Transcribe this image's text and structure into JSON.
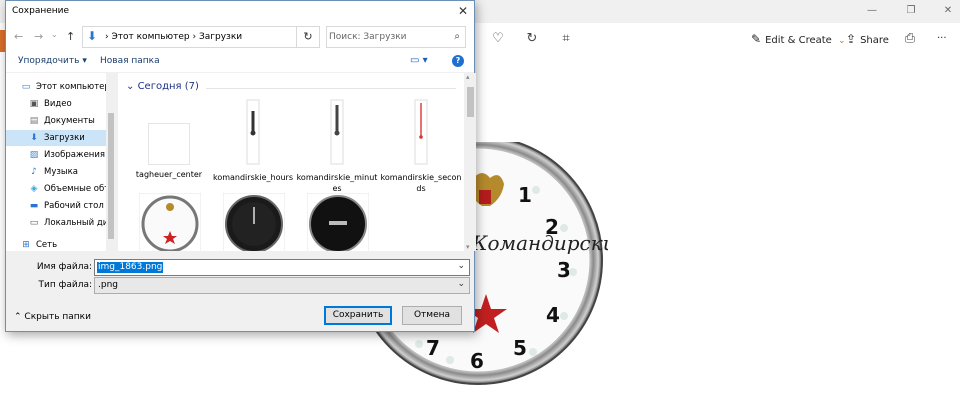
{
  "app": {
    "toolbar": {
      "edit_create": "Edit & Create",
      "share": "Share",
      "more": "···"
    },
    "photo": {
      "brand_text": "Командирские",
      "dial_numbers": [
        "1",
        "2",
        "3",
        "4",
        "5",
        "6",
        "7"
      ]
    },
    "colors": {
      "accent_orange": "#d86e2b"
    }
  },
  "dialog": {
    "title": "Сохранение",
    "address": {
      "crumb1": "Этот компьютер",
      "crumb2": "Загрузки"
    },
    "search_placeholder": "Поиск: Загрузки",
    "commands": {
      "organize": "Упорядочить",
      "new_folder": "Новая папка"
    },
    "tree": [
      {
        "label": "Этот компьютер"
      },
      {
        "label": "Видео"
      },
      {
        "label": "Документы"
      },
      {
        "label": "Загрузки",
        "selected": true
      },
      {
        "label": "Изображения"
      },
      {
        "label": "Музыка"
      },
      {
        "label": "Объемные объ"
      },
      {
        "label": "Рабочий стол"
      },
      {
        "label": "Локальный дис"
      },
      {
        "label": "Сеть"
      }
    ],
    "group_header": "Сегодня (7)",
    "files": [
      {
        "name": "tagheuer_center"
      },
      {
        "name": "komandirskie_hours"
      },
      {
        "name": "komandirskie_minutes"
      },
      {
        "name": "komandirskie_seconds"
      },
      {
        "name": ""
      },
      {
        "name": ""
      },
      {
        "name": ""
      }
    ],
    "filename_label": "Имя файла:",
    "filename_value": "img_1863.png",
    "filetype_label": "Тип файла:",
    "filetype_value": ".png",
    "hide_folders": "Скрыть папки",
    "save_button": "Сохранить",
    "cancel_button": "Отмена",
    "colors": {
      "selection": "#0078d7",
      "tree_selected": "#cce4f7"
    }
  }
}
